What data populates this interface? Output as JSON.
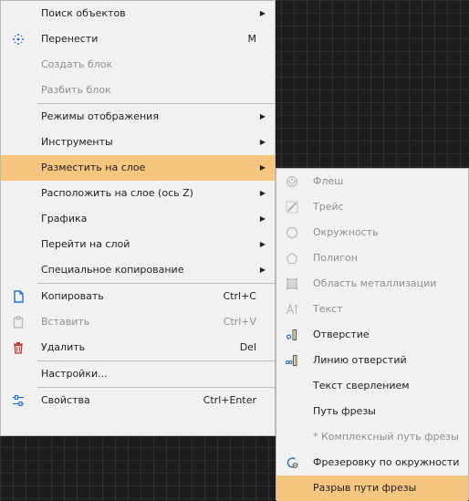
{
  "main_menu": {
    "items": [
      {
        "label": "Поиск объектов",
        "shortcut": "",
        "submenu": true
      },
      {
        "label": "Перенести",
        "shortcut": "M",
        "icon": "move-arrows-icon"
      },
      {
        "label": "Создать блок",
        "disabled": true
      },
      {
        "label": "Разбить блок",
        "disabled": true
      },
      {
        "label": "Режимы отображения",
        "submenu": true
      },
      {
        "label": "Инструменты",
        "submenu": true
      },
      {
        "label": "Разместить на слое",
        "submenu": true,
        "highlighted": true
      },
      {
        "label": "Расположить на слое (ось Z)",
        "submenu": true
      },
      {
        "label": "Графика",
        "submenu": true
      },
      {
        "label": "Перейти на слой",
        "submenu": true
      },
      {
        "label": "Специальное копирование",
        "submenu": true
      },
      {
        "label": "Копировать",
        "shortcut": "Ctrl+C",
        "icon": "copy-icon"
      },
      {
        "label": "Вставить",
        "shortcut": "Ctrl+V",
        "icon": "paste-icon",
        "disabled": true
      },
      {
        "label": "Удалить",
        "shortcut": "Del",
        "icon": "trash-icon"
      },
      {
        "label": "Настройки..."
      },
      {
        "label": "Свойства",
        "shortcut": "Ctrl+Enter",
        "icon": "properties-sliders-icon"
      }
    ],
    "arrow_glyph": "▶"
  },
  "sub_menu": {
    "items": [
      {
        "label": "Флеш",
        "icon": "flash-pad-icon",
        "disabled": true
      },
      {
        "label": "Трейс",
        "icon": "trace-icon",
        "disabled": true
      },
      {
        "label": "Окружность",
        "icon": "circle-icon",
        "disabled": true
      },
      {
        "label": "Полигон",
        "icon": "polygon-icon",
        "disabled": true
      },
      {
        "label": "Область металлизации",
        "icon": "metal-area-icon",
        "disabled": true
      },
      {
        "label": "Текст",
        "icon": "text-icon",
        "disabled": true
      },
      {
        "label": "Отверстие",
        "icon": "hole-icon"
      },
      {
        "label": "Линию отверстий",
        "icon": "hole-line-icon"
      },
      {
        "label": "Текст сверлением"
      },
      {
        "label": "Путь фрезы"
      },
      {
        "label": "* Комплексный путь фрезы",
        "disabled": true
      },
      {
        "label": "Фрезеровку по окружности",
        "icon": "circular-milling-icon"
      },
      {
        "label": "Разрыв пути фрезы",
        "highlighted": true
      }
    ]
  },
  "colors": {
    "menu_bg": "#f1f1f1",
    "highlight": "#f6c67f",
    "accent_blue": "#1f6fd6",
    "delete_red": "#c0392b",
    "canvas_bg": "#1c1c1c"
  }
}
